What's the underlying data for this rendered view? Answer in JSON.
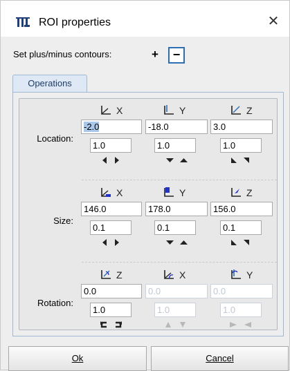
{
  "window": {
    "title": "ROI properties",
    "close_glyph": "✕"
  },
  "contours": {
    "label": "Set plus/minus contours:",
    "plus": "+",
    "minus": "−"
  },
  "tabs": [
    {
      "label": "Operations"
    }
  ],
  "location": {
    "label": "Location:",
    "axes": [
      "X",
      "Y",
      "Z"
    ],
    "values": [
      "-2.0",
      "-18.0",
      "3.0"
    ],
    "steps": [
      "1.0",
      "1.0",
      "1.0"
    ]
  },
  "size": {
    "label": "Size:",
    "axes": [
      "X",
      "Y",
      "Z"
    ],
    "values": [
      "146.0",
      "178.0",
      "156.0"
    ],
    "steps": [
      "0.1",
      "0.1",
      "0.1"
    ]
  },
  "rotation": {
    "label": "Rotation:",
    "axes": [
      "Z",
      "X",
      "Y"
    ],
    "values": [
      "0.0",
      "0.0",
      "0.0"
    ],
    "steps": [
      "1.0",
      "1.0",
      "1.0"
    ]
  },
  "buttons": {
    "ok": "Ok",
    "cancel": "Cancel"
  },
  "colors": {
    "accent": "#2d6db4",
    "tab_bg": "#dfe9f5",
    "selection": "#aac8ea"
  }
}
